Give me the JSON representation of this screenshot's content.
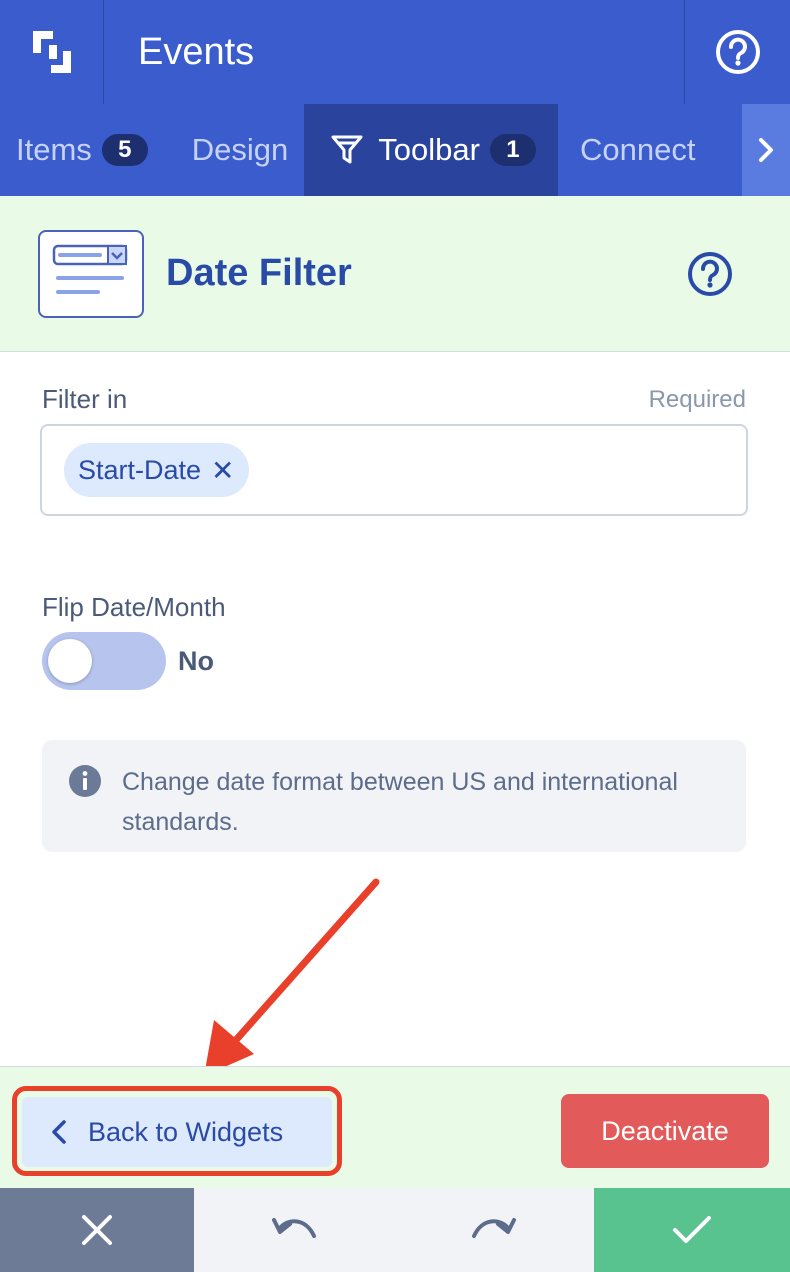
{
  "header": {
    "title": "Events"
  },
  "tabs": [
    {
      "label": "Items",
      "badge": "5"
    },
    {
      "label": "Design"
    },
    {
      "label": "Toolbar",
      "badge": "1"
    },
    {
      "label": "Connect"
    }
  ],
  "widget": {
    "title": "Date Filter"
  },
  "filter_in": {
    "label": "Filter in",
    "required": "Required",
    "chip": "Start-Date",
    "chip_remove": "✕"
  },
  "flip": {
    "label": "Flip Date/Month",
    "state": "No"
  },
  "info": {
    "text": "Change date format between US and international standards."
  },
  "footer": {
    "back_label": "Back to Widgets",
    "deactivate_label": "Deactivate"
  },
  "colors": {
    "header": "#3a5ccc",
    "accent": "#2a4aa8",
    "danger": "#e25a5a",
    "success": "#59c38f",
    "highlight": "#e8402a"
  }
}
